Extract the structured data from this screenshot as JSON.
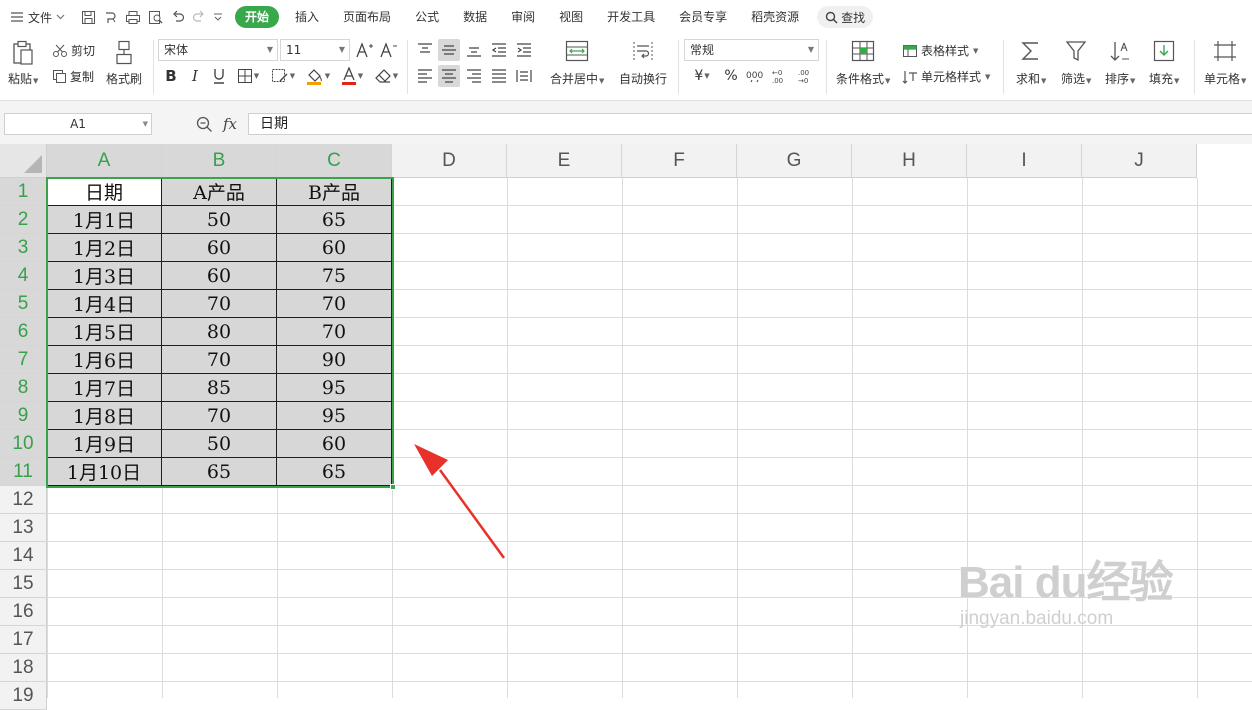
{
  "menubar": {
    "file_label": "文件",
    "tabs": [
      "开始",
      "插入",
      "页面布局",
      "公式",
      "数据",
      "审阅",
      "视图",
      "开发工具",
      "会员专享",
      "稻壳资源"
    ],
    "active_tab": "开始",
    "search_label": "查找"
  },
  "ribbon": {
    "paste": "粘贴",
    "cut": "剪切",
    "copy": "复制",
    "format_painter": "格式刷",
    "font_name": "宋体",
    "font_size": "11",
    "merge_center": "合并居中",
    "wrap_text": "自动换行",
    "number_format": "常规",
    "conditional_format": "条件格式",
    "table_style": "表格样式",
    "cell_style": "单元格样式",
    "sum": "求和",
    "filter": "筛选",
    "sort": "排序",
    "fill": "填充",
    "cell": "单元格",
    "currency_symbol": "¥",
    "percent_symbol": "%"
  },
  "formula_bar": {
    "name_box": "A1",
    "fx_label": "fx",
    "formula_value": "日期"
  },
  "sheet": {
    "columns": [
      "A",
      "B",
      "C",
      "D",
      "E",
      "F",
      "G",
      "H",
      "I",
      "J"
    ],
    "rows": [
      "1",
      "2",
      "3",
      "4",
      "5",
      "6",
      "7",
      "8",
      "9",
      "10",
      "11",
      "12",
      "13",
      "14",
      "15",
      "16",
      "17",
      "18",
      "19"
    ],
    "table": [
      [
        "日期",
        "A产品",
        "B产品"
      ],
      [
        "1月1日",
        "50",
        "65"
      ],
      [
        "1月2日",
        "60",
        "60"
      ],
      [
        "1月3日",
        "60",
        "75"
      ],
      [
        "1月4日",
        "70",
        "70"
      ],
      [
        "1月5日",
        "80",
        "70"
      ],
      [
        "1月6日",
        "70",
        "90"
      ],
      [
        "1月7日",
        "85",
        "95"
      ],
      [
        "1月8日",
        "70",
        "95"
      ],
      [
        "1月9日",
        "50",
        "60"
      ],
      [
        "1月10日",
        "65",
        "65"
      ]
    ]
  },
  "watermark": {
    "main": "Bai du经验",
    "sub": "jingyan.baidu.com"
  },
  "colors": {
    "accent_green": "#38a84b",
    "selection_fill": "#d7d7d7",
    "arrow_red": "#e8312a"
  }
}
